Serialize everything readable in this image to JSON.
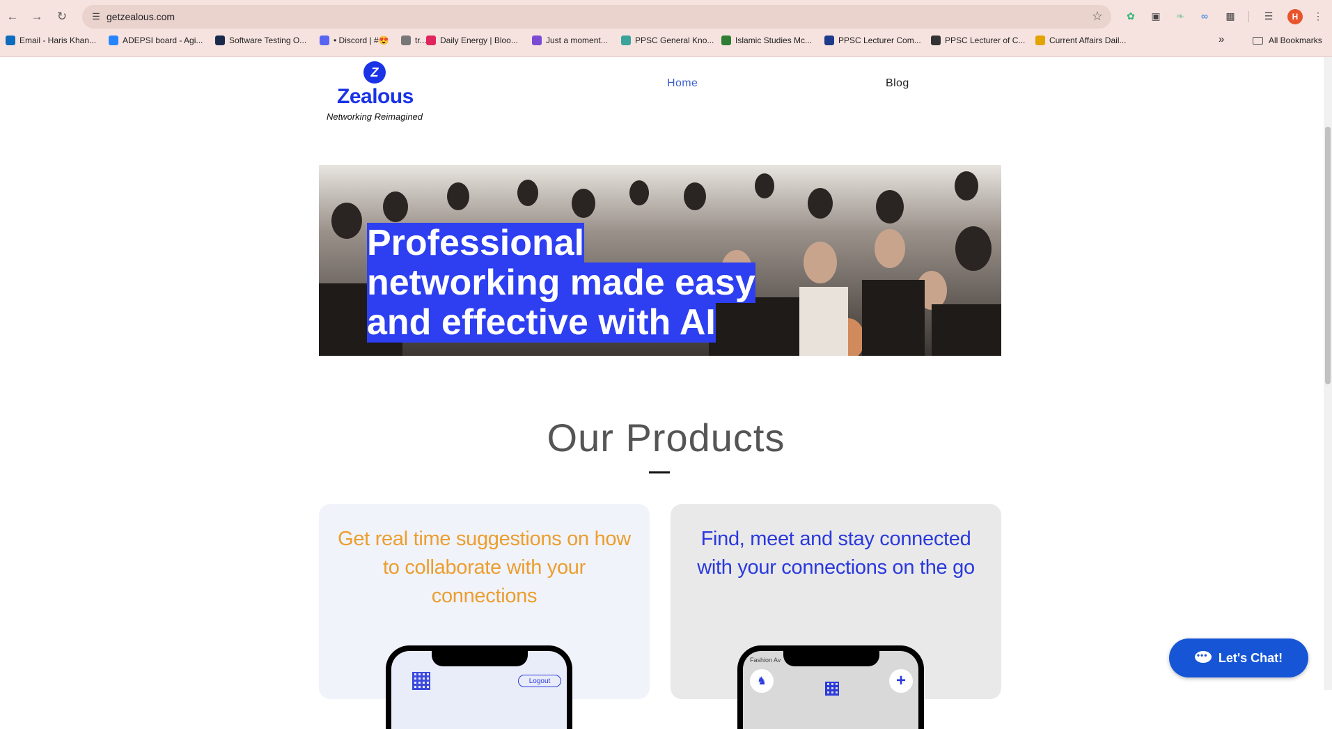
{
  "browser": {
    "url": "getzealous.com",
    "profile_initial": "H",
    "bookmarks": [
      {
        "label": "Email - Haris Khan...",
        "color": "#0f6cbd"
      },
      {
        "label": "ADEPSI board - Agi...",
        "color": "#2684ff"
      },
      {
        "label": "Software Testing O...",
        "color": "#1b2a4a"
      },
      {
        "label": "• Discord | #😍",
        "color": "#5865f2"
      },
      {
        "label": "tr...",
        "color": "#777777"
      },
      {
        "label": "Daily Energy | Bloo...",
        "color": "#e0245e"
      },
      {
        "label": "Just a moment...",
        "color": "#7b4bd6"
      },
      {
        "label": "PPSC General Kno...",
        "color": "#3aa39b"
      },
      {
        "label": "Islamic Studies Mc...",
        "color": "#2e7d32"
      },
      {
        "label": "PPSC Lecturer Com...",
        "color": "#1e3a8a"
      },
      {
        "label": "PPSC Lecturer of C...",
        "color": "#333333"
      },
      {
        "label": "Current Affairs Dail...",
        "color": "#e2a300"
      }
    ],
    "all_bookmarks": "All Bookmarks"
  },
  "header": {
    "logo_letter": "Z",
    "logo_text": "Zealous",
    "tagline": "Networking Reimagined",
    "nav": {
      "home": "Home",
      "blog": "Blog"
    }
  },
  "hero": {
    "title": "Professional networking made easy and effective with AI"
  },
  "products": {
    "title": "Our Products",
    "cards": [
      {
        "text": "Get real time suggestions on how to collaborate with your connections",
        "logout": "Logout"
      },
      {
        "text": "Find, meet and stay connected with your connections on the go",
        "map_label": "Fashion Av"
      }
    ]
  },
  "chat": {
    "label": "Let's Chat!"
  },
  "colors": {
    "brand_blue": "#1a33e6",
    "highlight_blue": "#2d3ff0",
    "orange": "#eb9e2e",
    "chat_blue": "#1656d6"
  }
}
